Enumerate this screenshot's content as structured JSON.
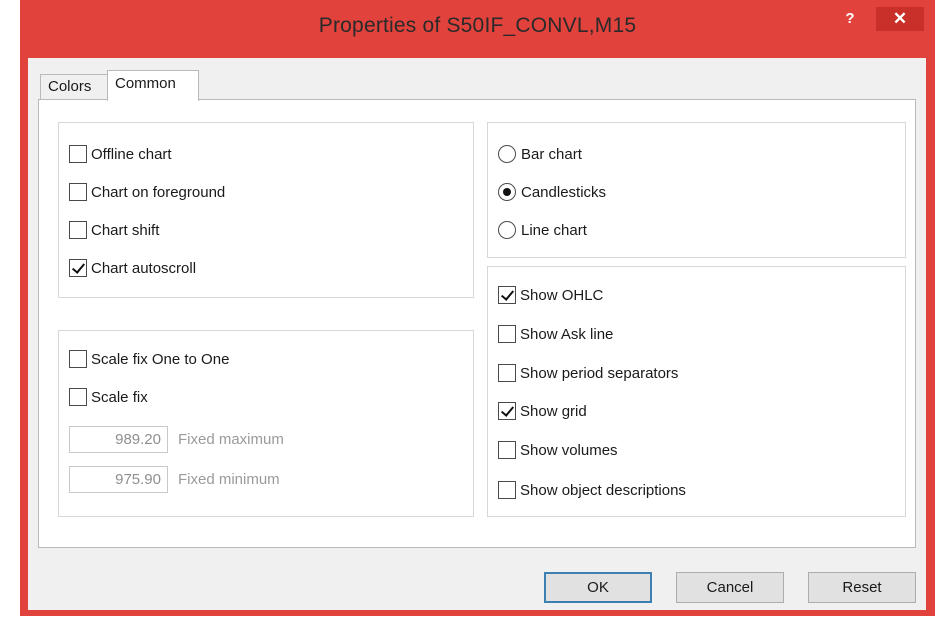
{
  "window": {
    "title": "Properties of S50IF_CONVL,M15",
    "help_glyph": "?",
    "close_glyph": "✕",
    "frame_color": "#e1423c"
  },
  "tabs": [
    {
      "label": "Colors",
      "active": false
    },
    {
      "label": "Common",
      "active": true
    }
  ],
  "chart_options": [
    {
      "label": "Offline chart",
      "checked": false
    },
    {
      "label": "Chart on foreground",
      "checked": false
    },
    {
      "label": "Chart shift",
      "checked": false
    },
    {
      "label": "Chart autoscroll",
      "checked": true
    }
  ],
  "scale": {
    "options": [
      {
        "label": "Scale fix One to One",
        "checked": false
      },
      {
        "label": "Scale fix",
        "checked": false
      }
    ],
    "fixed_maximum": {
      "value": "989.20",
      "label": "Fixed maximum"
    },
    "fixed_minimum": {
      "value": "975.90",
      "label": "Fixed minimum"
    }
  },
  "chart_type": {
    "options": [
      {
        "label": "Bar chart",
        "selected": false
      },
      {
        "label": "Candlesticks",
        "selected": true
      },
      {
        "label": "Line chart",
        "selected": false
      }
    ]
  },
  "show_options": [
    {
      "label": "Show OHLC",
      "checked": true
    },
    {
      "label": "Show Ask line",
      "checked": false
    },
    {
      "label": "Show period separators",
      "checked": false
    },
    {
      "label": "Show grid",
      "checked": true
    },
    {
      "label": "Show volumes",
      "checked": false
    },
    {
      "label": "Show object descriptions",
      "checked": false
    }
  ],
  "buttons": {
    "ok": "OK",
    "cancel": "Cancel",
    "reset": "Reset"
  }
}
